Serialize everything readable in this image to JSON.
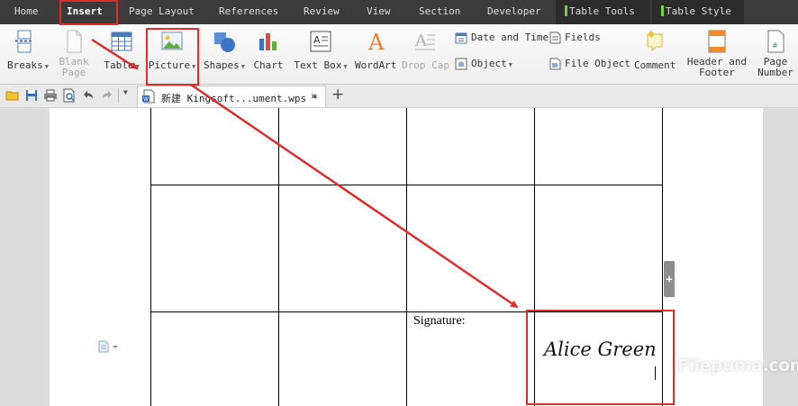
{
  "menu": {
    "tabs": [
      {
        "label": "Home"
      },
      {
        "label": "Insert"
      },
      {
        "label": "Page Layout"
      },
      {
        "label": "References"
      },
      {
        "label": "Review"
      },
      {
        "label": "View"
      },
      {
        "label": "Section"
      },
      {
        "label": "Developer"
      }
    ],
    "context_tabs": [
      {
        "label": "Table Tools"
      },
      {
        "label": "Table Style"
      }
    ],
    "active_tab": "Insert"
  },
  "ribbon": {
    "breaks": "Breaks",
    "blank_page": [
      "Blank",
      "Page"
    ],
    "table": "Table",
    "picture": "Picture",
    "shapes": "Shapes",
    "chart": "Chart",
    "text_box": "Text Box",
    "wordart": "WordArt",
    "drop_cap": "Drop Cap",
    "date_time": "Date and Time",
    "object": "Object",
    "fields": "Fields",
    "file_object": "File Object",
    "comment": "Comment",
    "header_footer": [
      "Header and",
      "Footer"
    ],
    "page_number": [
      "Page",
      "Number"
    ]
  },
  "doc_tab": {
    "title": "新建 Kingsoft...ument.wps *",
    "close": "×",
    "new_tab": "+"
  },
  "document": {
    "signature_label": "Signature:",
    "signature_text": "Alice Green"
  },
  "watermark": "Filepuma.com",
  "colors": {
    "menubar": "#3b3b3b",
    "annotation_red": "#e12c2c",
    "context_tab_marker": "#7cd13c"
  },
  "icons": [
    "breaks-icon",
    "blank-page-icon",
    "table-icon",
    "picture-icon",
    "shapes-icon",
    "chart-icon",
    "text-box-icon",
    "wordart-icon",
    "drop-cap-icon",
    "date-time-icon",
    "object-icon",
    "fields-icon",
    "file-object-icon",
    "comment-icon",
    "header-footer-icon",
    "page-number-icon",
    "open-folder-icon",
    "save-icon",
    "print-icon",
    "print-preview-icon",
    "undo-icon",
    "redo-icon",
    "document-icon",
    "paragraph-icon"
  ]
}
